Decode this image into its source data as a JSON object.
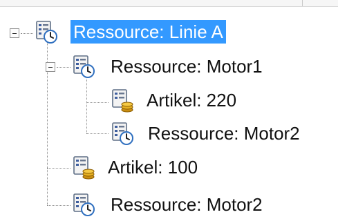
{
  "tree": {
    "root": {
      "label": "Ressource: Linie A",
      "icon": "resource-icon",
      "selected": true,
      "expanded": true
    },
    "motor1": {
      "label": "Ressource: Motor1",
      "icon": "resource-icon",
      "expanded": true
    },
    "artikel220": {
      "label": "Artikel: 220",
      "icon": "article-icon"
    },
    "motor2_child": {
      "label": "Ressource: Motor2",
      "icon": "resource-icon"
    },
    "artikel100": {
      "label": "Artikel: 100",
      "icon": "article-icon"
    },
    "motor2": {
      "label": "Ressource: Motor2",
      "icon": "resource-icon"
    }
  },
  "colors": {
    "selection": "#3399ff",
    "connector": "#8f8f8f"
  }
}
